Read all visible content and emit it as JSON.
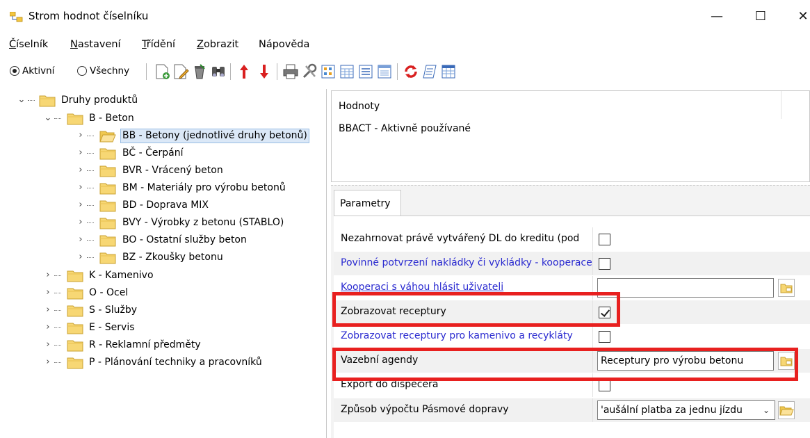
{
  "window": {
    "title": "Strom hodnot číselníku",
    "minimize_glyph": "—",
    "maximize_glyph": "☐",
    "close_glyph": "✕"
  },
  "menu": [
    {
      "underline": "Č",
      "rest": "íselník"
    },
    {
      "underline": "N",
      "rest": "astavení"
    },
    {
      "underline": "T",
      "rest": "řídění"
    },
    {
      "underline": "Z",
      "rest": "obrazit"
    },
    {
      "underline": "",
      "rest": "Nápověda"
    }
  ],
  "filter": {
    "active_label": "Aktivní",
    "all_label": "Všechny",
    "selected": "active"
  },
  "tree": {
    "root": "Druhy produktů",
    "items": [
      {
        "label": "B - Beton"
      },
      {
        "label": "BB - Betony (jednotlivé druhy betonů)",
        "selected": true
      },
      {
        "label": "BČ - Čerpání"
      },
      {
        "label": "BVR - Vrácený beton"
      },
      {
        "label": "BM - Materiály pro výrobu betonů"
      },
      {
        "label": "BD - Doprava MIX"
      },
      {
        "label": "BVY - Výrobky z betonu (STABLO)"
      },
      {
        "label": "BO - Ostatní služby beton"
      },
      {
        "label": "BZ - Zkoušky betonu"
      },
      {
        "label": "K - Kamenivo"
      },
      {
        "label": "O - Ocel"
      },
      {
        "label": "S - Služby"
      },
      {
        "label": "E - Servis"
      },
      {
        "label": "R - Reklamní předměty"
      },
      {
        "label": "P - Plánování techniky a pracovníků"
      }
    ]
  },
  "values": {
    "header": "Hodnoty",
    "rows": [
      "BBACT - Aktivně používané"
    ]
  },
  "params": {
    "tab_label": "Parametry",
    "rows": [
      {
        "label": "Nezahrnovat právě vytvářený DL do kreditu (pod",
        "checked": false
      },
      {
        "label": "Povinné potvrzení nakládky či vykládky - kooperace",
        "checked": false
      },
      {
        "label": "Kooperaci s váhou hlásit uživateli",
        "value": ""
      },
      {
        "label": "Zobrazovat receptury",
        "checked": true
      },
      {
        "label": "Zobrazovat receptury pro kamenivo a recykláty",
        "checked": false
      },
      {
        "label": "Vazební agendy",
        "value": "Receptury pro výrobu betonu"
      },
      {
        "label": "Export do dispečera",
        "checked": false
      },
      {
        "label": "Způsob výpočtu Pásmové dopravy",
        "value": "'aušální platba za jednu jízdu"
      }
    ]
  },
  "colors": {
    "highlight": "#e8201f",
    "link": "#2a2ad0",
    "selection": "#dbe8f7",
    "folder": "#f7d774"
  }
}
